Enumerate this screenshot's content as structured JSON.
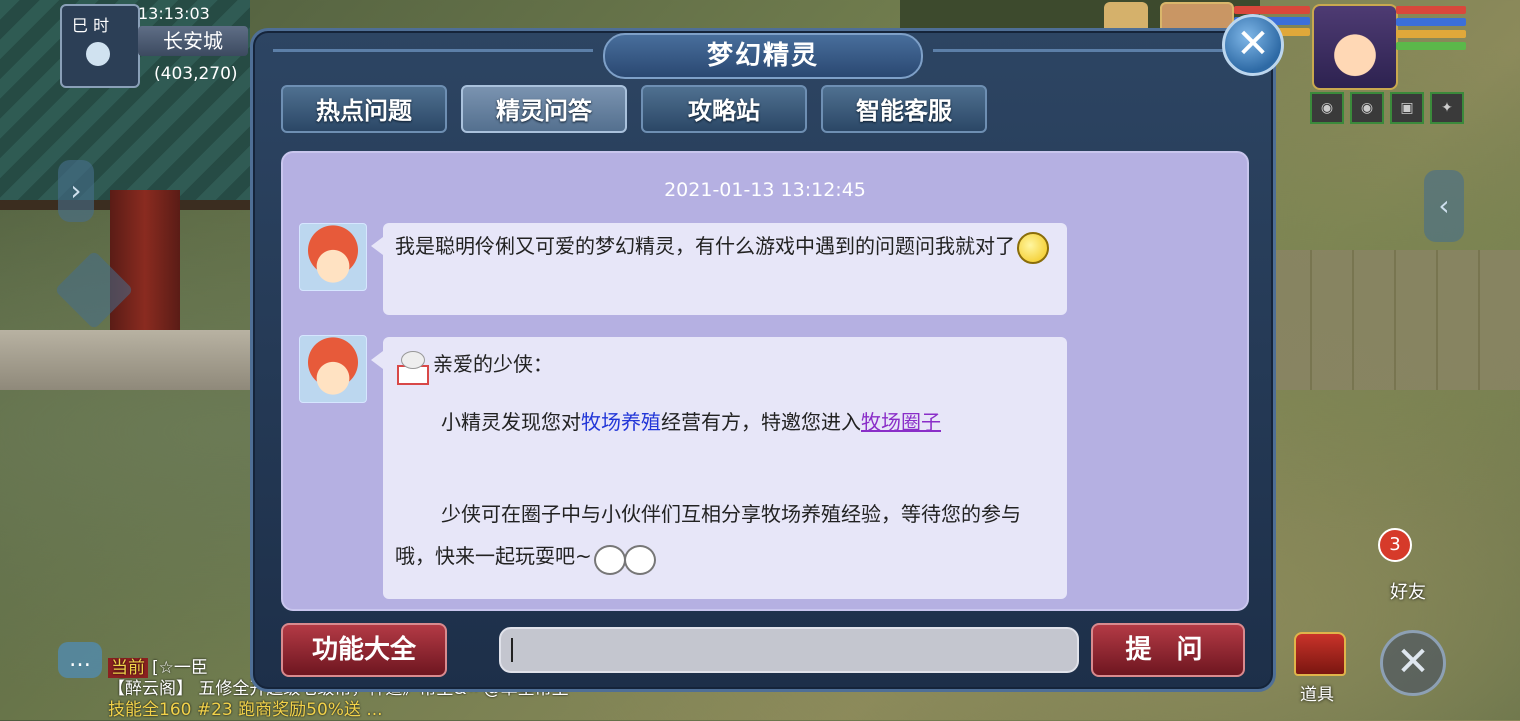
{
  "hud": {
    "time_label": "巳 时",
    "clock": "13:13:03",
    "city": "长安城",
    "coords": "(403,270)",
    "friend_badge": "3",
    "friend_label": "好友",
    "item_label": "道具"
  },
  "dialog": {
    "title": "梦幻精灵",
    "close_symbol": "✕",
    "tabs": [
      {
        "label": "热点问题"
      },
      {
        "label": "精灵问答"
      },
      {
        "label": "攻略站"
      },
      {
        "label": "智能客服"
      }
    ],
    "timestamp": "2021-01-13 13:12:45",
    "messages": [
      {
        "text": "我是聪明伶俐又可爱的梦幻精灵，有什么游戏中遇到的问题问我就对了"
      },
      {
        "greeting": "亲爱的少侠：",
        "line1_prefix": "小精灵发现您对",
        "line1_highlight": "牧场养殖",
        "line1_middle": "经营有方，特邀您进入",
        "line1_link": "牧场圈子",
        "line2": "少侠可在圈子中与小伙伴们互相分享牧场养殖经验，等待您的参与哦，快来一起玩耍吧~"
      }
    ],
    "func_button": "功能大全",
    "ask_button": "提 问",
    "input_value": ""
  },
  "bottom_chat": {
    "channel_tag": "当前",
    "line1": "[☆一臣",
    "line2": "【醉云阁】 五修全开超级七级帮，神道》帮主&〃@草堂帮主",
    "line3": "技能全160 #23 跑商奖励50%送 ..."
  },
  "colors": {
    "dialog_bg": "#2d4563",
    "chat_bg": "#b5b0e2",
    "bubble_bg": "#e7e6f8",
    "link_blue": "#2236d8",
    "link_purple": "#8a2ec8",
    "red_button": "#b33a45"
  }
}
